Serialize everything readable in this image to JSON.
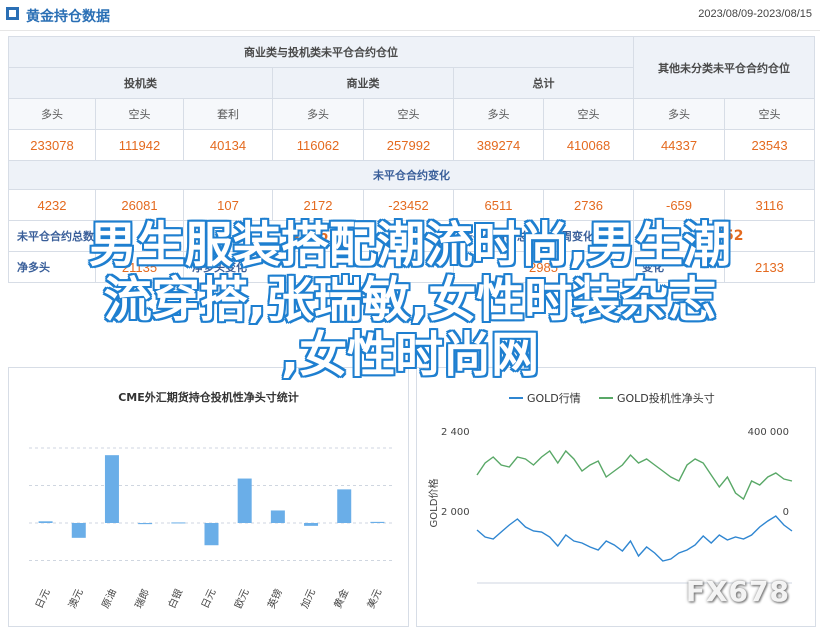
{
  "header": {
    "title": "黄金持仓数据",
    "date_range": "2023/08/09-2023/08/15"
  },
  "table": {
    "group_commercial": "商业类与投机类未平仓合约仓位",
    "group_other": "其他未分类未平仓合约仓位",
    "sub_spec": "投机类",
    "sub_comm": "商业类",
    "sub_total": "总计",
    "col_labels": [
      "多头",
      "空头",
      "套利",
      "多头",
      "空头",
      "多头",
      "空头",
      "多头",
      "空头"
    ],
    "values": [
      "233078",
      "111942",
      "40134",
      "116062",
      "257992",
      "389274",
      "410068",
      "44337",
      "23543"
    ],
    "section_change": "未平仓合约变化",
    "changes": [
      "4232",
      "26081",
      "107",
      "2172",
      "-23452",
      "6511",
      "2736",
      "-659",
      "3116"
    ],
    "stat1_label": "未平仓合约总数",
    "stat1_value": "433611",
    "stat2_label": "未平仓合约总数较上周变化",
    "stat2_value": "5852",
    "stat3_label": "净多头",
    "stat3_value": "21135",
    "stat4_label": "净多头变化",
    "stat4_value": "2985",
    "stat4b_label": "变化",
    "stat4b_value": "2133"
  },
  "chart_left": {
    "chart_data": {
      "type": "bar",
      "title": "CME外汇期货持仓投机性净头寸统计",
      "categories": [
        "日元",
        "澳元",
        "原油",
        "瑞郎",
        "白银",
        "日元",
        "欧元",
        "英镑",
        "加元",
        "黄金",
        "美元"
      ],
      "values": [
        0.3,
        -2.6,
        11.9,
        -0.2,
        0.1,
        -3.9,
        7.8,
        2.2,
        -0.5,
        5.9,
        0.2
      ],
      "ylabel": "",
      "grid": true
    }
  },
  "chart_right": {
    "chart_data": {
      "type": "line",
      "title": "",
      "legend_position": "top",
      "y_left_label": "GOLD价格",
      "y_left_ticks": [
        "2 400",
        "2 000"
      ],
      "y_right_ticks": [
        "400 000",
        "0"
      ],
      "series": [
        {
          "name": "GOLD行情",
          "color": "#2f86d1",
          "values": [
            1905,
            1870,
            1860,
            1895,
            1930,
            1960,
            1920,
            1900,
            1895,
            1870,
            1825,
            1880,
            1850,
            1840,
            1820,
            1805,
            1850,
            1830,
            1800,
            1850,
            1775,
            1820,
            1790,
            1750,
            1760,
            1790,
            1805,
            1830,
            1875,
            1840,
            1880,
            1855,
            1870,
            1860,
            1880,
            1920,
            1950,
            1975,
            1930,
            1900
          ]
        },
        {
          "name": "GOLD投机性净头寸",
          "color": "#59a867",
          "values": [
            180,
            240,
            270,
            230,
            220,
            270,
            260,
            230,
            270,
            300,
            240,
            300,
            260,
            200,
            230,
            250,
            170,
            200,
            230,
            280,
            240,
            260,
            230,
            200,
            170,
            150,
            230,
            260,
            240,
            180,
            120,
            170,
            90,
            60,
            150,
            130,
            170,
            190,
            160,
            150
          ]
        }
      ]
    }
  },
  "overlay": {
    "line1": "男生服装搭配潮流时尚,男生潮",
    "line2": "流穿搭,张瑞敏,女性时装杂志",
    "line3": ",女性时尚网"
  },
  "watermark": "FX678"
}
